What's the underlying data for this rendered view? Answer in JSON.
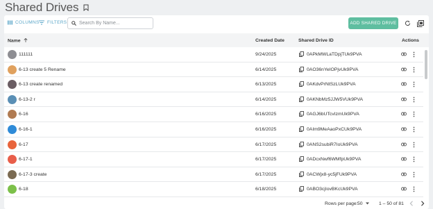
{
  "page": {
    "title": "Shared Drives"
  },
  "toolbar": {
    "columns_label": "COLUMNS",
    "filters_label": "FILTERS",
    "search_placeholder": "Search By Name...",
    "add_label": "ADD SHARED DRIVE"
  },
  "table": {
    "columns": {
      "name": "Name",
      "created": "Created Date",
      "id": "Shared Drive ID",
      "actions": "Actions"
    },
    "sort": {
      "column": "Name",
      "direction": "ascending"
    },
    "rows": [
      {
        "name": "111111",
        "created": "9/24/2025",
        "id": "0APkMWLaTDpjTUk9PVA",
        "avatar": "#8e8e93"
      },
      {
        "name": "6-13 create 5 Rename",
        "created": "6/14/2025",
        "id": "0AO36nYeIOPjvUk9PVA",
        "avatar": "#e0a15e"
      },
      {
        "name": "6-13 create renamed",
        "created": "6/13/2025",
        "id": "0AKdvPrNtSzLUk9PVA",
        "avatar": "#6a5d63"
      },
      {
        "name": "6-13-2 r",
        "created": "6/14/2025",
        "id": "0AKNbMz5JJW5VUk9PVA",
        "avatar": "#5a8fb5"
      },
      {
        "name": "6-16",
        "created": "6/16/2025",
        "id": "0AGJ6bUTcvIzmUk9PVA",
        "avatar": "#b07b52"
      },
      {
        "name": "6-16-1",
        "created": "6/16/2025",
        "id": "0AIm9MeAaoPxCUk9PVA",
        "avatar": "#2e8bd8"
      },
      {
        "name": "6-17",
        "created": "6/17/2025",
        "id": "0ANS2subiR7IoUk9PVA",
        "avatar": "#e8643c"
      },
      {
        "name": "6-17-1",
        "created": "6/17/2025",
        "id": "0ADcxNwf6WMfpUk9PVA",
        "avatar": "#e85e4a"
      },
      {
        "name": "6-17-3 create",
        "created": "6/17/2025",
        "id": "0ACWjx8-yc5jFUk9PVA",
        "avatar": "#7a6a52"
      },
      {
        "name": "6-18",
        "created": "6/18/2025",
        "id": "0ABO3cjIovBKcUk9PVA",
        "avatar": "#7cc04a"
      }
    ]
  },
  "pagination": {
    "rows_per_page_label": "Rows per page:",
    "rows_per_page": "50",
    "range": "1 – 50 of 81"
  },
  "colors": {
    "accent": "#5fbea0",
    "link": "#5aa6c8"
  }
}
